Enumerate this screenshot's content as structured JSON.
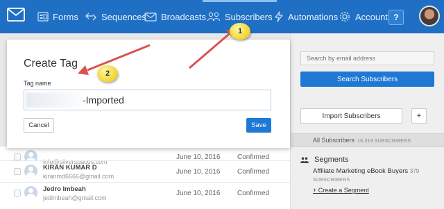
{
  "nav": {
    "items": [
      {
        "label": "Forms",
        "icon": "forms-icon"
      },
      {
        "label": "Sequences",
        "icon": "sequences-icon"
      },
      {
        "label": "Broadcasts",
        "icon": "broadcasts-icon"
      },
      {
        "label": "Subscribers",
        "icon": "subscribers-icon",
        "active": true
      },
      {
        "label": "Automations",
        "icon": "automations-icon"
      },
      {
        "label": "Account",
        "icon": "gear-icon"
      }
    ],
    "help_label": "?"
  },
  "modal": {
    "title": "Create Tag",
    "field_label": "Tag name",
    "tag_value": "-Imported",
    "cancel_label": "Cancel",
    "save_label": "Save"
  },
  "subscribers": {
    "rows": [
      {
        "name": "",
        "email": "info@silverspaces.com",
        "date": "June 10, 2016",
        "status": "Confirmed"
      },
      {
        "name": "KIRAN KUMAR D",
        "email": "kiranmd6666@gmail.com",
        "date": "June 10, 2016",
        "status": "Confirmed"
      },
      {
        "name": "Jedro Imbeah",
        "email": "jedimbeah@gmail.com",
        "date": "June 10, 2016",
        "status": "Confirmed"
      }
    ]
  },
  "sidebar": {
    "search_placeholder": "Search by email address",
    "search_button": "Search Subscribers",
    "import_button": "Import Subscribers",
    "plus_button": "+",
    "all_subscribers_label": "All Subscribers",
    "all_subscribers_count": "16,319 SUBSCRIBERS",
    "segments_title": "Segments",
    "segment_name": "Affiliate Marketing eBook Buyers",
    "segment_count": "379",
    "segment_unit": "SUBSCRIBERS",
    "create_segment": "+ Create a Segment"
  },
  "annotations": {
    "badge1": "1",
    "badge2": "2"
  },
  "colors": {
    "nav_bg": "#1f6fc5",
    "primary_button": "#1f79d4",
    "arrow": "#d9534f",
    "badge": "#f3d83a"
  }
}
